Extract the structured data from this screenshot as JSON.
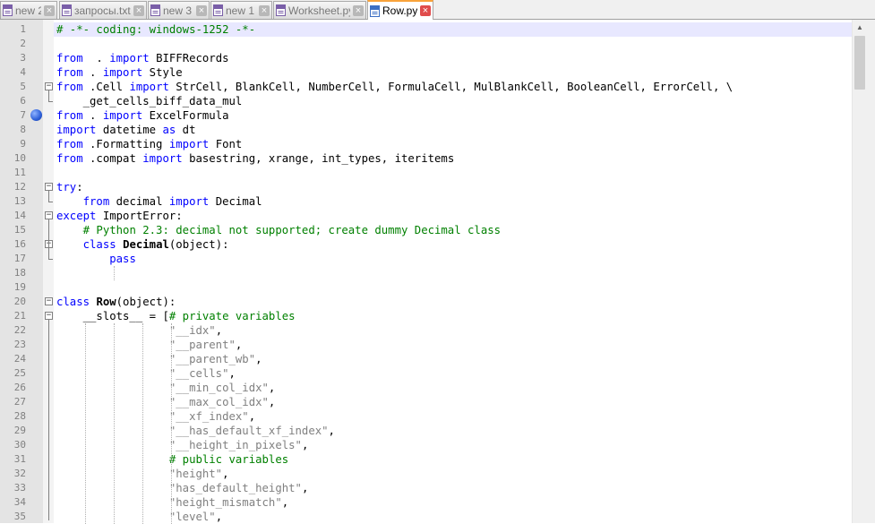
{
  "tabs": [
    {
      "label": "new 2",
      "active": false,
      "icon": "file-icon"
    },
    {
      "label": "запросы.txt",
      "active": false,
      "icon": "file-icon"
    },
    {
      "label": "new 3",
      "active": false,
      "icon": "file-icon"
    },
    {
      "label": "new 1",
      "active": false,
      "icon": "file-icon"
    },
    {
      "label": "Worksheet.py",
      "active": false,
      "icon": "file-icon"
    },
    {
      "label": "Row.py",
      "active": true,
      "icon": "save-file-icon"
    }
  ],
  "close_glyph": "×",
  "code_lines": [
    [
      [
        "cm",
        "# -*- coding: windows-1252 -*-"
      ]
    ],
    [],
    [
      [
        "kw",
        "from"
      ],
      [
        "",
        "  . "
      ],
      [
        "kw",
        "import"
      ],
      [
        "",
        " BIFFRecords"
      ]
    ],
    [
      [
        "kw",
        "from"
      ],
      [
        "",
        " . "
      ],
      [
        "kw",
        "import"
      ],
      [
        "",
        " Style"
      ]
    ],
    [
      [
        "kw",
        "from"
      ],
      [
        "",
        " .Cell "
      ],
      [
        "kw",
        "import"
      ],
      [
        "",
        " StrCell, BlankCell, NumberCell, FormulaCell, MulBlankCell, BooleanCell, ErrorCell, \\"
      ]
    ],
    [
      [
        "",
        "    _get_cells_biff_data_mul"
      ]
    ],
    [
      [
        "kw",
        "from"
      ],
      [
        "",
        " . "
      ],
      [
        "kw",
        "import"
      ],
      [
        "",
        " ExcelFormula"
      ]
    ],
    [
      [
        "kw",
        "import"
      ],
      [
        "",
        " datetime "
      ],
      [
        "kw",
        "as"
      ],
      [
        "",
        " dt"
      ]
    ],
    [
      [
        "kw",
        "from"
      ],
      [
        "",
        " .Formatting "
      ],
      [
        "kw",
        "import"
      ],
      [
        "",
        " Font"
      ]
    ],
    [
      [
        "kw",
        "from"
      ],
      [
        "",
        " .compat "
      ],
      [
        "kw",
        "import"
      ],
      [
        "",
        " basestring, xrange, int_types, iteritems"
      ]
    ],
    [],
    [
      [
        "kw",
        "try"
      ],
      [
        "",
        ":"
      ]
    ],
    [
      [
        "",
        "    "
      ],
      [
        "kw",
        "from"
      ],
      [
        "",
        " decimal "
      ],
      [
        "kw",
        "import"
      ],
      [
        "",
        " Decimal"
      ]
    ],
    [
      [
        "kw",
        "except"
      ],
      [
        "",
        " ImportError:"
      ]
    ],
    [
      [
        "",
        "    "
      ],
      [
        "cm",
        "# Python 2.3: decimal not supported; create dummy Decimal class"
      ]
    ],
    [
      [
        "",
        "    "
      ],
      [
        "kw",
        "class"
      ],
      [
        "",
        " "
      ],
      [
        "cls",
        "Decimal"
      ],
      [
        "",
        "(object):"
      ]
    ],
    [
      [
        "",
        "        "
      ],
      [
        "kw",
        "pass"
      ]
    ],
    [],
    [],
    [
      [
        "kw",
        "class"
      ],
      [
        "",
        " "
      ],
      [
        "cls",
        "Row"
      ],
      [
        "",
        "(object):"
      ]
    ],
    [
      [
        "",
        "    __slots__ = ["
      ],
      [
        "cm",
        "# private variables"
      ]
    ],
    [
      [
        "",
        "                 "
      ],
      [
        "st",
        "\"__idx\""
      ],
      [
        "",
        ","
      ]
    ],
    [
      [
        "",
        "                 "
      ],
      [
        "st",
        "\"__parent\""
      ],
      [
        "",
        ","
      ]
    ],
    [
      [
        "",
        "                 "
      ],
      [
        "st",
        "\"__parent_wb\""
      ],
      [
        "",
        ","
      ]
    ],
    [
      [
        "",
        "                 "
      ],
      [
        "st",
        "\"__cells\""
      ],
      [
        "",
        ","
      ]
    ],
    [
      [
        "",
        "                 "
      ],
      [
        "st",
        "\"__min_col_idx\""
      ],
      [
        "",
        ","
      ]
    ],
    [
      [
        "",
        "                 "
      ],
      [
        "st",
        "\"__max_col_idx\""
      ],
      [
        "",
        ","
      ]
    ],
    [
      [
        "",
        "                 "
      ],
      [
        "st",
        "\"__xf_index\""
      ],
      [
        "",
        ","
      ]
    ],
    [
      [
        "",
        "                 "
      ],
      [
        "st",
        "\"__has_default_xf_index\""
      ],
      [
        "",
        ","
      ]
    ],
    [
      [
        "",
        "                 "
      ],
      [
        "st",
        "\"__height_in_pixels\""
      ],
      [
        "",
        ","
      ]
    ],
    [
      [
        "",
        "                 "
      ],
      [
        "cm",
        "# public variables"
      ]
    ],
    [
      [
        "",
        "                 "
      ],
      [
        "st",
        "\"height\""
      ],
      [
        "",
        ","
      ]
    ],
    [
      [
        "",
        "                 "
      ],
      [
        "st",
        "\"has_default_height\""
      ],
      [
        "",
        ","
      ]
    ],
    [
      [
        "",
        "                 "
      ],
      [
        "st",
        "\"height_mismatch\""
      ],
      [
        "",
        ","
      ]
    ],
    [
      [
        "",
        "                 "
      ],
      [
        "st",
        "\"level\""
      ],
      [
        "",
        ","
      ]
    ]
  ],
  "bookmark_line": 7,
  "fold_markers": [
    {
      "line": 5,
      "type": "box",
      "sign": "−"
    },
    {
      "line": 6,
      "type": "end"
    },
    {
      "line": 12,
      "type": "box",
      "sign": "−"
    },
    {
      "line": 13,
      "type": "end"
    },
    {
      "line": 14,
      "type": "box",
      "sign": "−"
    },
    {
      "line": 16,
      "type": "box",
      "sign": "−"
    },
    {
      "line": 17,
      "type": "end"
    },
    {
      "line": 20,
      "type": "box",
      "sign": "−"
    },
    {
      "line": 21,
      "type": "box",
      "sign": "−"
    }
  ],
  "scroll_up_glyph": "▲"
}
